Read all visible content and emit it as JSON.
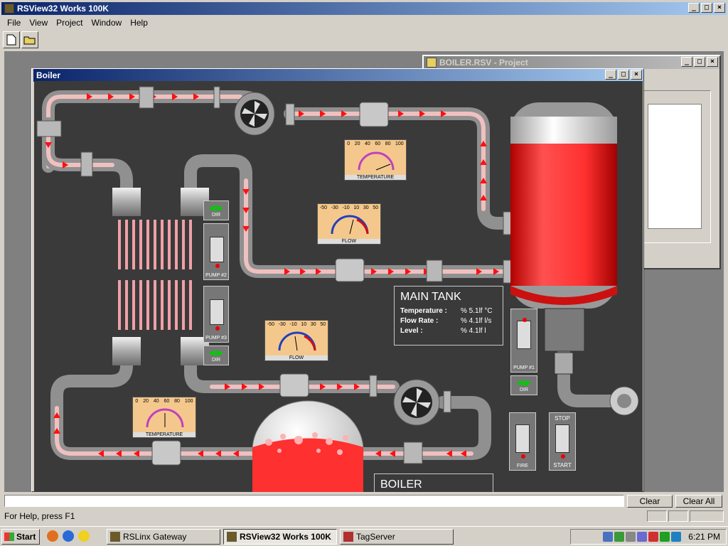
{
  "app": {
    "title": "RSView32 Works 100K"
  },
  "menu": [
    "File",
    "View",
    "Project",
    "Window",
    "Help"
  ],
  "project_window": {
    "title": "BOILER.RSV - Project"
  },
  "boiler_window": {
    "title": "Boiler"
  },
  "gauges": {
    "temp_top": {
      "ticks": [
        "0",
        "20",
        "40",
        "60",
        "80",
        "100"
      ],
      "label": "TEMPERATURE"
    },
    "flow_mid": {
      "ticks": [
        "-50",
        "-30",
        "-10",
        "10",
        "30",
        "50"
      ],
      "label": "FLOW"
    },
    "flow_low": {
      "ticks": [
        "-50",
        "-30",
        "-10",
        "10",
        "30",
        "50"
      ],
      "label": "FLOW"
    },
    "temp_low": {
      "ticks": [
        "0",
        "20",
        "40",
        "60",
        "80",
        "100"
      ],
      "label": "TEMPERATURE"
    }
  },
  "main_tank": {
    "title": "MAIN TANK",
    "rows": [
      {
        "label": "Temperature :",
        "value": "% 5.1lf °C"
      },
      {
        "label": "Flow Rate :",
        "value": "% 4.1lf l/s"
      },
      {
        "label": "Level :",
        "value": "% 4.1lf l"
      }
    ],
    "level_fraction": 0.82
  },
  "boiler_label": "BOILER",
  "controls": {
    "dir": "DIR",
    "pump2": "PUMP #2",
    "pump3": "PUMP #3",
    "pump1": "PUMP #1",
    "fire": "FIRE",
    "stop": "STOP",
    "start": "START"
  },
  "command": {
    "clear": "Clear",
    "clear_all": "Clear All"
  },
  "status": {
    "help": "For Help, press F1"
  },
  "taskbar": {
    "start": "Start",
    "tasks": [
      "RSLinx Gateway",
      "RSView32 Works 100K",
      "TagServer"
    ],
    "clock": "6:21 PM"
  },
  "colors": {
    "pipe": "#c8c8c8",
    "flow": "#e81010",
    "tank": "#ff2a2a",
    "canvas": "#3a3a3a",
    "gauge": "#f4c88c"
  }
}
